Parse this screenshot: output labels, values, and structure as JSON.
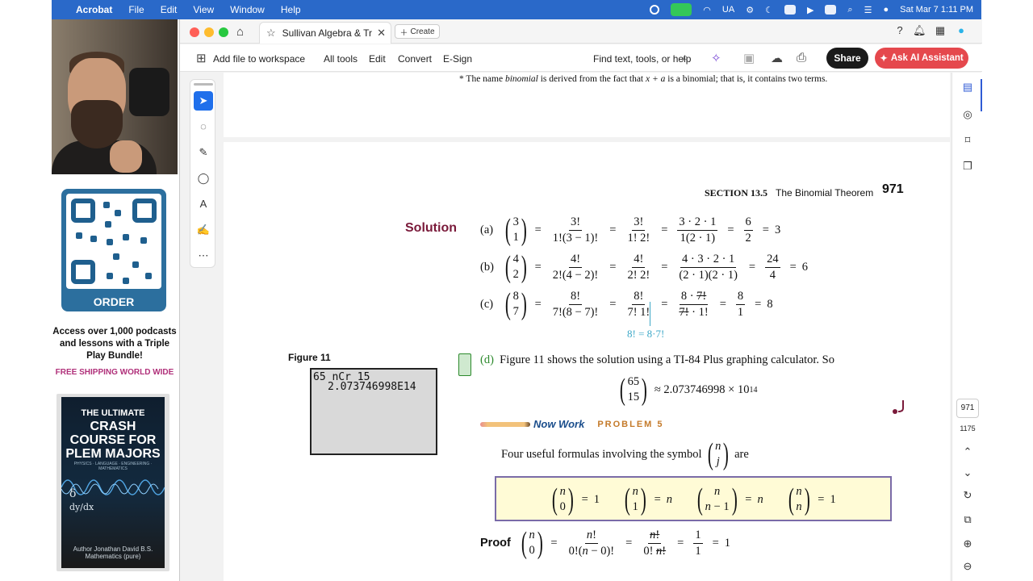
{
  "menubar": {
    "app": "Acrobat",
    "items": [
      "File",
      "Edit",
      "View",
      "Window",
      "Help"
    ],
    "input_source": "UA",
    "datetime": "Sat Mar 7  1:11 PM"
  },
  "sidebar": {
    "qr_label": "ORDER",
    "promo": "Access over 1,000 podcasts and lessons with a Triple Play Bundle!",
    "shipping": "FREE SHIPPING WORLD WIDE",
    "book": {
      "line1": "THE ULTIMATE",
      "line2": "CRASH COURSE FOR PLEM MAJORS",
      "subtitle": "PHYSICS · LANGUAGE · ENGINEERING · MATHEMATICS",
      "author": "Author Jonathan David B.S. Mathematics (pure)"
    }
  },
  "tabbar": {
    "tab_title": "Sullivan Algebra & Trig...",
    "create_label": "Create"
  },
  "toolbar": {
    "add_file": "Add file to workspace",
    "all_tools": "All tools",
    "edit": "Edit",
    "convert": "Convert",
    "esign": "E-Sign",
    "find": "Find text, tools, or help",
    "share": "Share",
    "ai": "Ask AI Assistant"
  },
  "rail": {
    "page_current": "971",
    "page_total": "1175"
  },
  "doc": {
    "footnote_prefix": "* The name ",
    "footnote_italic": "binomial",
    "footnote_mid": " is derived from the fact that ",
    "footnote_expr": "x + a",
    "footnote_end": " is a binomial; that is, it contains two terms.",
    "section_label": "SECTION 13.5",
    "section_title": "The Binomial Theorem",
    "page_number": "971",
    "solution": "Solution",
    "figure_label": "Figure 11",
    "calc_line1": "65 nCr 15",
    "calc_line2": "2.073746998E14",
    "annotation": "8! = 8·7!",
    "part_d_label": "(d)",
    "part_d_text": "Figure 11 shows the solution using a TI-84 Plus graphing calculator. So",
    "approx_value": "≈ 2.073746998 × 10",
    "approx_exp": "14",
    "now_work": "Now Work",
    "problem": "PROBLEM 5",
    "useful_text": "Four useful formulas involving the symbol",
    "useful_end": "are",
    "proof": "Proof"
  }
}
